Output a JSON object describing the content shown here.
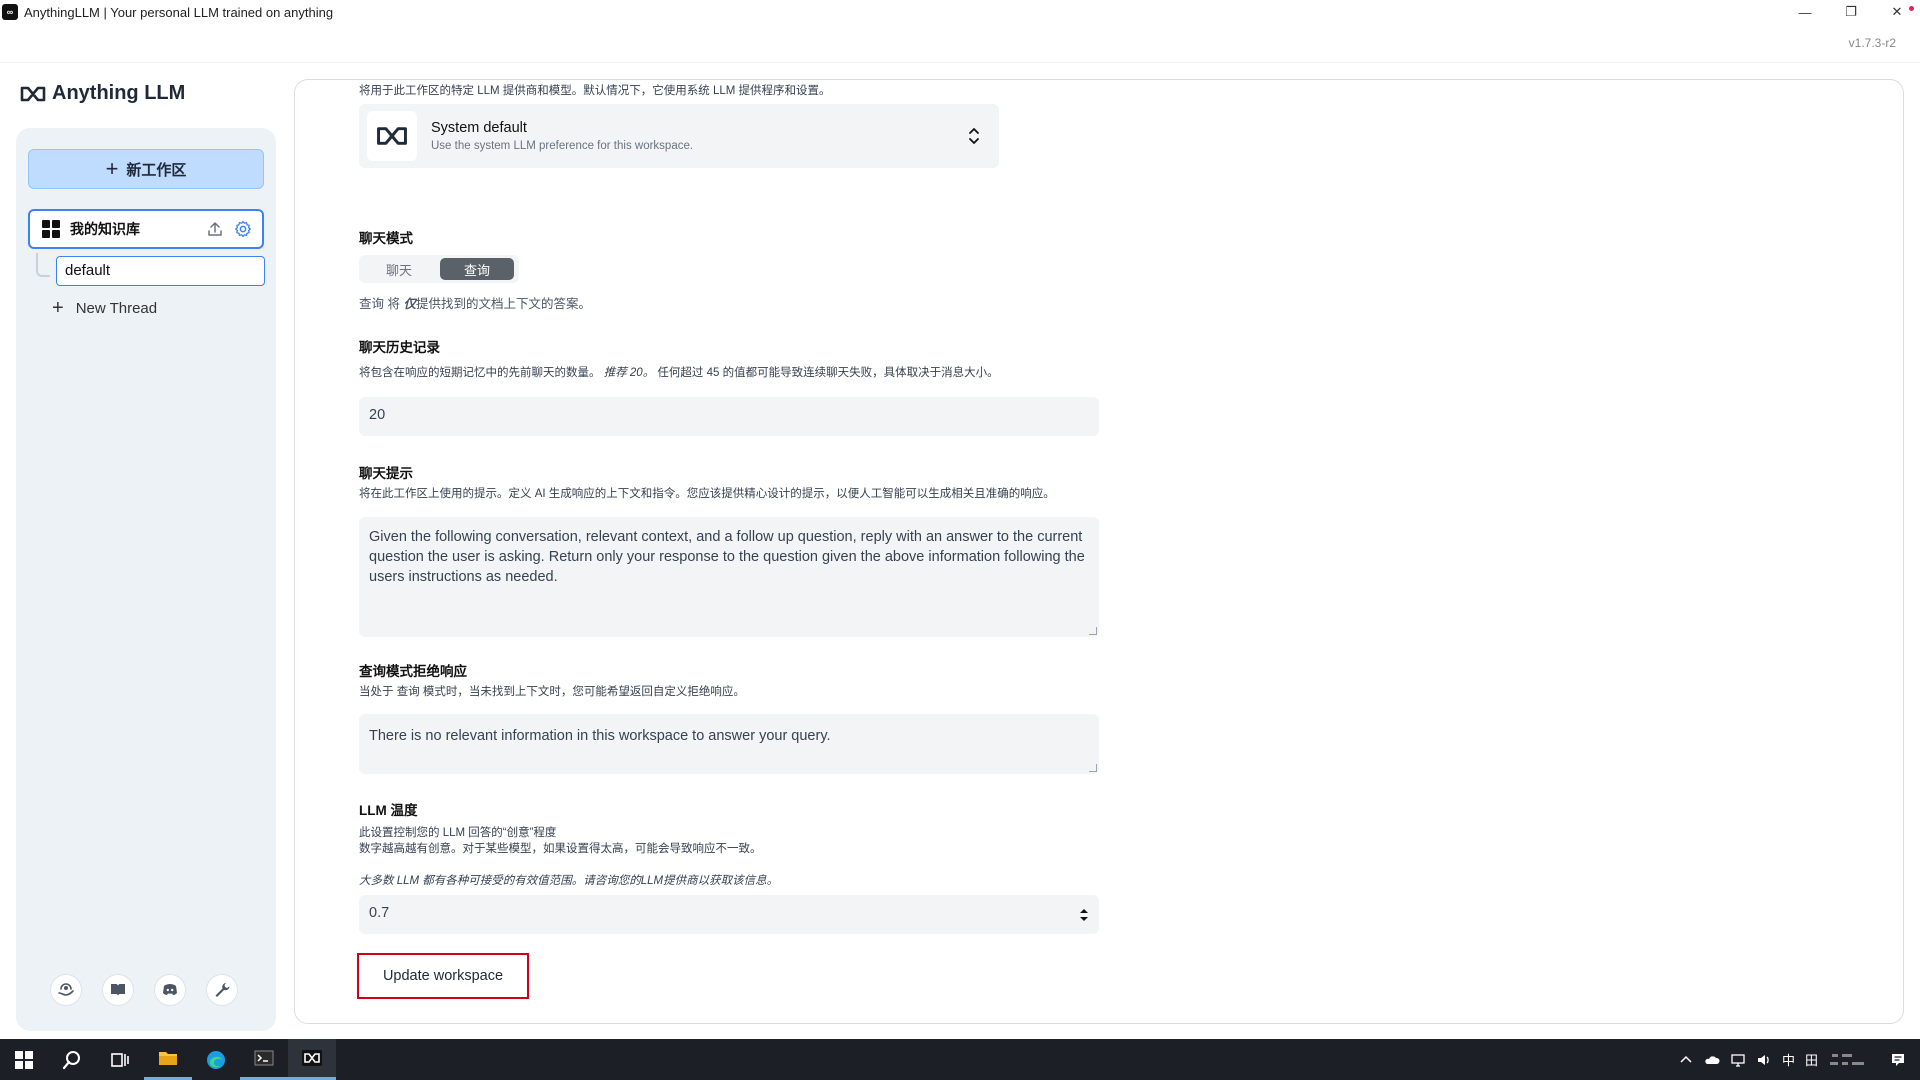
{
  "window": {
    "title": "AnythingLLM | Your personal LLM trained on anything",
    "app_icon_text": "∞",
    "minimize": "—",
    "restore": "❐",
    "close": "✕",
    "version": "v1.7.3-r2"
  },
  "sidebar": {
    "logo_text": "Anything LLM",
    "new_workspace_label": "新工作区",
    "workspace_name": "我的知识库",
    "thread_name": "default",
    "new_thread_label": "New Thread",
    "footer_icons": [
      "community-hub-icon",
      "docs-book-icon",
      "discord-icon",
      "settings-wrench-icon"
    ]
  },
  "main": {
    "llm_provider_desc": "将用于此工作区的特定 LLM 提供商和模型。默认情况下，它使用系统 LLM 提供程序和设置。",
    "llm_select_title": "System default",
    "llm_select_desc": "Use the system LLM preference for this workspace.",
    "chat_mode_heading": "聊天模式",
    "chat_mode_options": [
      "聊天",
      "查询"
    ],
    "chat_mode_selected": "查询",
    "chat_mode_help_prefix": "查询 将",
    "chat_mode_help_em": "仅",
    "chat_mode_help_suffix": "提供找到的文档上下文的答案。",
    "history_heading": "聊天历史记录",
    "history_desc_prefix": "将包含在响应的短期记忆中的先前聊天的数量。",
    "history_desc_em": "推荐 20。",
    "history_desc_suffix": "任何超过 45 的值都可能导致连续聊天失败，具体取决于消息大小。",
    "history_value": "20",
    "prompt_heading": "聊天提示",
    "prompt_desc": "将在此工作区上使用的提示。定义 AI 生成响应的上下文和指令。您应该提供精心设计的提示，以便人工智能可以生成相关且准确的响应。",
    "prompt_value": "Given the following conversation, relevant context, and a follow up question, reply with an answer to the current question the user is asking. Return only your response to the question given the above information following the users instructions as needed.",
    "refusal_heading": "查询模式拒绝响应",
    "refusal_desc": "当处于 查询 模式时，当未找到上下文时，您可能希望返回自定义拒绝响应。",
    "refusal_value": "There is no relevant information in this workspace to answer your query.",
    "temp_heading": "LLM 温度",
    "temp_desc_line1": "此设置控制您的 LLM 回答的“创意”程度",
    "temp_desc_line2": "数字越高越有创意。对于某些模型，如果设置得太高，可能会导致响应不一致。",
    "temp_note": "大多数 LLM 都有各种可接受的有效值范围。请咨询您的LLM提供商以获取该信息。",
    "temp_value": "0.7",
    "update_button": "Update workspace"
  },
  "taskbar": {
    "apps": [
      "windows-start-icon",
      "search-icon",
      "task-view-icon",
      "file-explorer-icon",
      "edge-browser-icon",
      "terminal-icon",
      "anythingllm-icon"
    ],
    "tray_ime": "中",
    "tray_grid": "田"
  },
  "colors": {
    "accent": "#3b82f6",
    "new_ws_bg": "#bfdbfe",
    "highlight_border": "#d0021b",
    "taskbar_bg": "#1c1f26"
  }
}
